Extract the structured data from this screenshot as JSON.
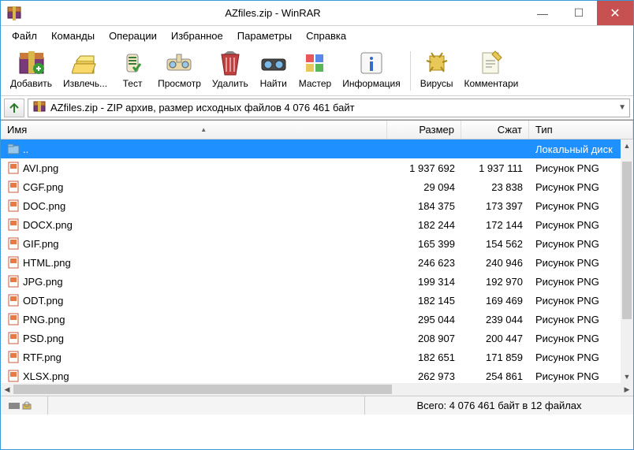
{
  "title": "AZfiles.zip - WinRAR",
  "menu": [
    "Файл",
    "Команды",
    "Операции",
    "Избранное",
    "Параметры",
    "Справка"
  ],
  "toolbar": [
    {
      "label": "Добавить",
      "icon": "add"
    },
    {
      "label": "Извлечь...",
      "icon": "extract"
    },
    {
      "label": "Тест",
      "icon": "test"
    },
    {
      "label": "Просмотр",
      "icon": "view"
    },
    {
      "label": "Удалить",
      "icon": "delete"
    },
    {
      "label": "Найти",
      "icon": "find"
    },
    {
      "label": "Мастер",
      "icon": "wizard"
    },
    {
      "label": "Информация",
      "icon": "info"
    },
    {
      "sep": true
    },
    {
      "label": "Вирусы",
      "icon": "virus"
    },
    {
      "label": "Комментари",
      "icon": "comment"
    }
  ],
  "path": "AZfiles.zip - ZIP архив, размер исходных файлов 4 076 461 байт",
  "columns": {
    "name": "Имя",
    "size": "Размер",
    "packed": "Сжат",
    "type": "Тип"
  },
  "parent_row": {
    "name": "..",
    "type": "Локальный диск"
  },
  "files": [
    {
      "name": "AVI.png",
      "size": "1 937 692",
      "packed": "1 937 111",
      "type": "Рисунок PNG"
    },
    {
      "name": "CGF.png",
      "size": "29 094",
      "packed": "23 838",
      "type": "Рисунок PNG"
    },
    {
      "name": "DOC.png",
      "size": "184 375",
      "packed": "173 397",
      "type": "Рисунок PNG"
    },
    {
      "name": "DOCX.png",
      "size": "182 244",
      "packed": "172 144",
      "type": "Рисунок PNG"
    },
    {
      "name": "GIF.png",
      "size": "165 399",
      "packed": "154 562",
      "type": "Рисунок PNG"
    },
    {
      "name": "HTML.png",
      "size": "246 623",
      "packed": "240 946",
      "type": "Рисунок PNG"
    },
    {
      "name": "JPG.png",
      "size": "199 314",
      "packed": "192 970",
      "type": "Рисунок PNG"
    },
    {
      "name": "ODT.png",
      "size": "182 145",
      "packed": "169 469",
      "type": "Рисунок PNG"
    },
    {
      "name": "PNG.png",
      "size": "295 044",
      "packed": "239 044",
      "type": "Рисунок PNG"
    },
    {
      "name": "PSD.png",
      "size": "208 907",
      "packed": "200 447",
      "type": "Рисунок PNG"
    },
    {
      "name": "RTF.png",
      "size": "182 651",
      "packed": "171 859",
      "type": "Рисунок PNG"
    },
    {
      "name": "XLSX.png",
      "size": "262 973",
      "packed": "254 861",
      "type": "Рисунок PNG"
    }
  ],
  "status": "Всего: 4 076 461 байт в 12 файлах"
}
